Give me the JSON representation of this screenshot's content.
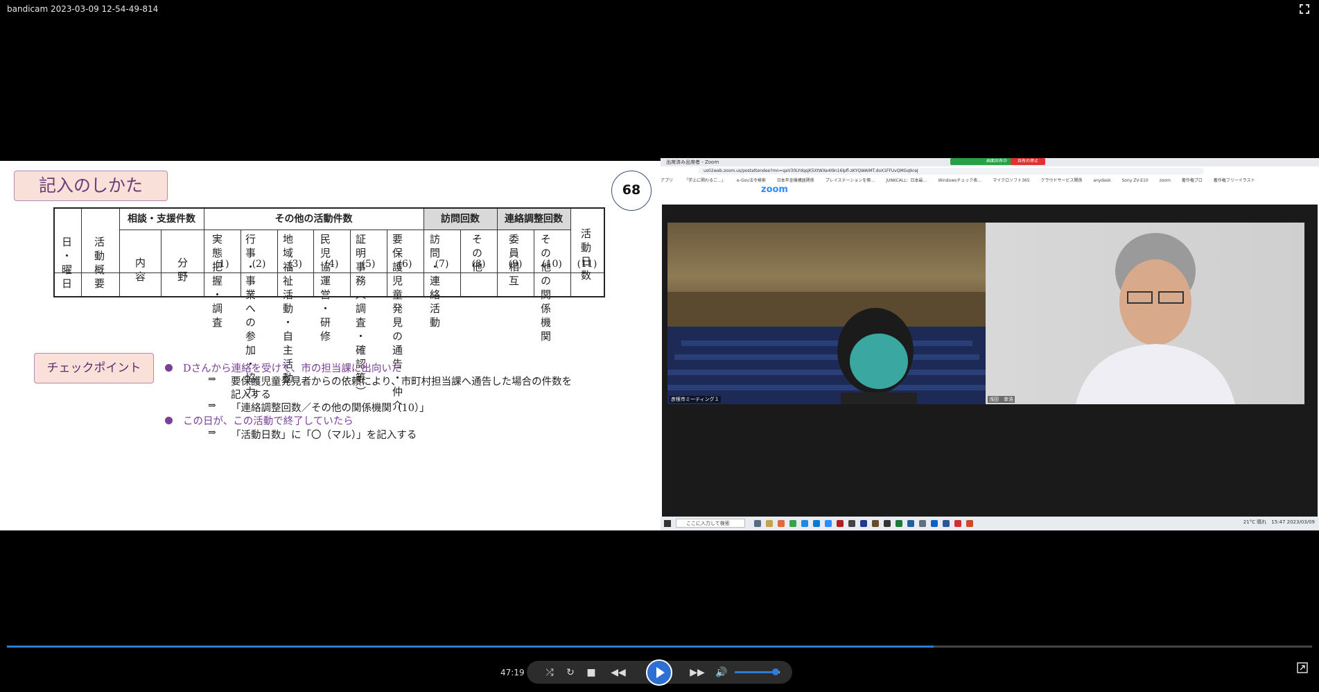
{
  "window": {
    "title": "bandicam 2023-03-09 12-54-49-814"
  },
  "slide": {
    "heading": "記入のしかた",
    "page_number": "68",
    "table": {
      "group_consult": "相談・支援件数",
      "group_other": "その他の活動件数",
      "group_visit": "訪問回数",
      "group_liaison": "連絡調整回数",
      "col_date": "日・曜日",
      "col_summary": "活動概要",
      "col_content": "内容",
      "col_field": "分野",
      "col_1": "実態把握・調査",
      "col_2": "行事・事業への参加・協力",
      "col_3": "地域福祉活動・自主活動",
      "col_4": "民児協運営・研修",
      "col_5": "証明事務（調査・確認等）",
      "col_6": "要保護児童発見の通告・仲介",
      "col_7": "訪問・連絡活動",
      "col_8": "その他",
      "col_9": "委員相互",
      "col_10": "その他の関係機関",
      "col_11": "活動日数",
      "n1": "(1)",
      "n2": "(2)",
      "n3": "(3)",
      "n4": "(4)",
      "n5": "(5)",
      "n6": "(6)",
      "n7": "(7)",
      "n8": "(8)",
      "n9": "(9)",
      "n10": "(10)",
      "n11": "(11)"
    },
    "checkpoint_label": "チェックポイント",
    "point1": "Dさんから連絡を受けて、市の担当課に出向いた",
    "arrow": "⇒",
    "point1_line1": "要保護児童発見者からの依頼により、市町村担当課へ通告した場合の件数を",
    "point1_line2": "記入する",
    "point1_line3": "「連絡調整回数／その他の関係機関（10）」",
    "point2": "この日が、この活動で終了していたら",
    "point2_line1": "「活動日数」に「〇（マル）」を記入する"
  },
  "zoom": {
    "tab_title": "出席済み出席者 - Zoom",
    "share_status": "画面共有中",
    "stop_share": "共有の停止",
    "url": "us02web.zoom.us/postattendee?mn=qaV30LYdqsjK5XtWXe4I9n16lpfl-zKYQWAIMT.doX1FFUvQMGq9ceJ",
    "bookmarks": [
      "アプリ",
      "「学上に関わるご…」",
      "e-Gov法令検索",
      "日本年金機構届関係",
      "プレイステーションを築…",
      "JUNKCALL：日本最…",
      "Windowsチェック表…",
      "マイクロソフト365",
      "クラウドサービス関係",
      "anydesk",
      "Sony ZV-E10",
      "zoom",
      "著作権プロ",
      "著作権フリーイラスト"
    ],
    "logo": "zoom",
    "participant_left": "彦根市ミーティング１",
    "participant_right": "浅田　幸浩",
    "search_placeholder": "ここに入力して検索",
    "tray": "21°C 晴れ　15:47 2023/03/09"
  },
  "player": {
    "time": "47:19",
    "progress_fraction": 0.71,
    "volume_fraction": 0.9
  }
}
